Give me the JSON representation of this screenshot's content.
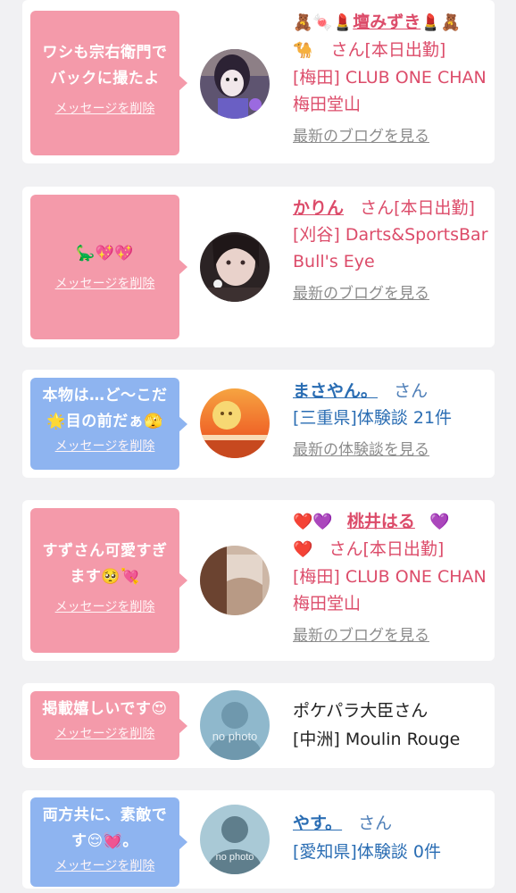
{
  "cards": [
    {
      "message": "ワシも宗右衛門でバックに撮たよ",
      "delete_label": "メッセージを削除",
      "name_prefix": "🧸🍬💄",
      "name": "壇みずき",
      "name_suffix": "💄🧸",
      "name_line2": "🐪",
      "san": "さん[本日出勤]",
      "shop": "[梅田] CLUB ONE CHAN 梅田堂山",
      "link": "最新のブログを見る"
    },
    {
      "message_emoji": "🦕💖💖",
      "delete_label": "メッセージを削除",
      "name": "かりん",
      "san": "さん[本日出勤]",
      "shop": "[刈谷] Darts&SportsBar Bull's Eye",
      "link": "最新のブログを見る"
    },
    {
      "message": "本物は…ど～こだ🌟目の前だぁ🫣",
      "delete_label": "メッセージを削除",
      "name": "まさやん。",
      "san": "さん",
      "shop": "[三重県]体験談 21件",
      "link": "最新の体験談を見る"
    },
    {
      "message": "すずさん可愛すぎます🥺💘",
      "delete_label": "メッセージを削除",
      "name_prefix": "❤️💜",
      "name": "桃井はる",
      "name_suffix": "💜",
      "name_line2": "❤️",
      "san": "さん[本日出勤]",
      "shop": "[梅田] CLUB ONE CHAN 梅田堂山",
      "link": "最新のブログを見る"
    },
    {
      "message": "掲載嬉しいです😍",
      "delete_label": "メッセージを削除",
      "name": "ポケパラ大臣さん",
      "shop": "[中洲] Moulin Rouge",
      "avatar_text": "no photo"
    },
    {
      "message": "両方共に、素敵です😌💓。",
      "delete_label": "メッセージを削除",
      "name": "やす。",
      "san": "さん",
      "shop": "[愛知県]体験談 0件",
      "avatar_text": "no photo"
    }
  ],
  "colors": {
    "pink_bubble": "#f49aaa",
    "blue_bubble": "#8eb4f0",
    "pink_text": "#dc4c6a",
    "blue_text": "#2a6db3"
  }
}
